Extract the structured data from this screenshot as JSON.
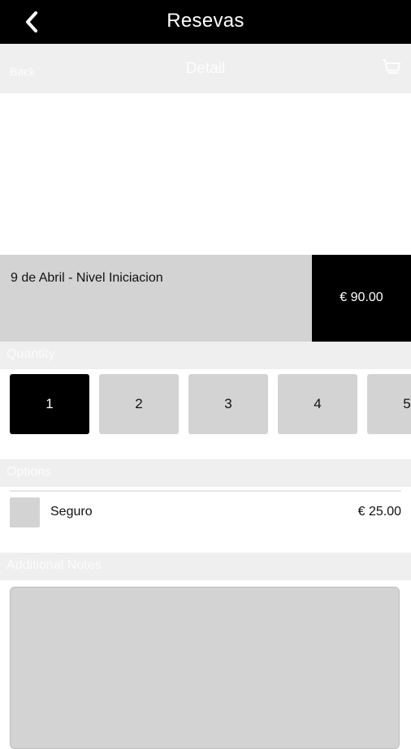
{
  "header": {
    "title": "Resevas",
    "back_icon": "chevron-left-icon"
  },
  "subheader": {
    "back_label": "Back",
    "title": "Detail",
    "cart_icon": "cart-icon"
  },
  "product": {
    "name": "9 de Abril - Nivel Iniciacion",
    "price": "€ 90.00"
  },
  "quantity": {
    "label": "Quantity",
    "options": [
      "1",
      "2",
      "3",
      "4",
      "5"
    ],
    "selected": "1"
  },
  "options": {
    "label": "Options",
    "items": [
      {
        "label": "Seguro",
        "price": "€ 25.00",
        "checked": false
      }
    ]
  },
  "notes": {
    "label": "Additional Notes",
    "value": ""
  },
  "colors": {
    "bar": "#000000",
    "section_bg": "#efefef",
    "tile": "#d3d3d3"
  }
}
